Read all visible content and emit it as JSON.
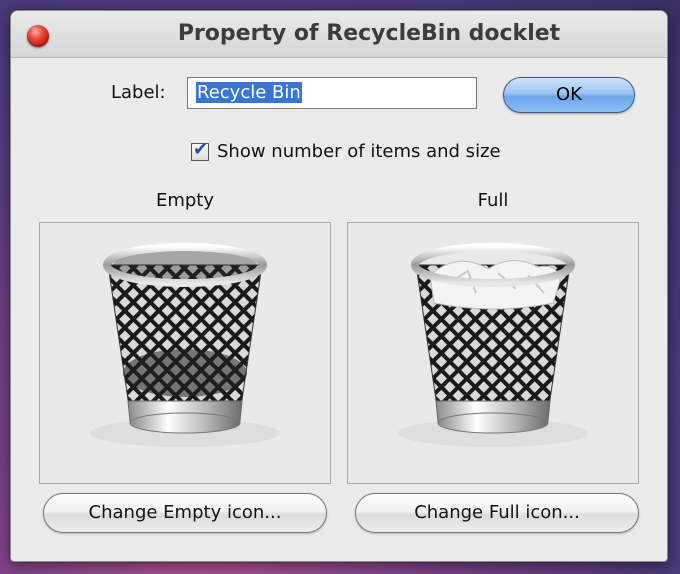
{
  "window": {
    "title": "Property of RecycleBin docklet"
  },
  "form": {
    "label_caption": "Label:",
    "label_value": "Recycle Bin",
    "ok_label": "OK",
    "show_count_label": "Show number of items and size",
    "show_count_checked": true
  },
  "empty": {
    "title": "Empty",
    "change_label": "Change Empty icon..."
  },
  "full": {
    "title": "Full",
    "change_label": "Change Full icon..."
  },
  "icons": {
    "close": "close-icon",
    "empty_bin": "trash-empty-icon",
    "full_bin": "trash-full-icon",
    "check": "checkmark-icon"
  },
  "colors": {
    "selection": "#3875d7",
    "close_red": "#e0281c",
    "ok_blue": "#8ec0f5"
  }
}
